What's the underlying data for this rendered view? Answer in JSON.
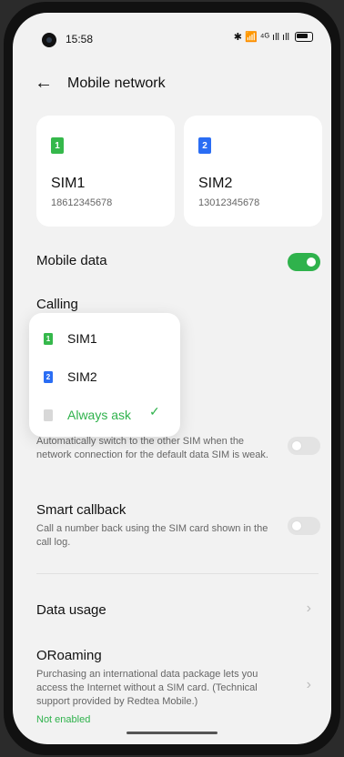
{
  "status": {
    "time": "15:58",
    "icons": "✱ 📶 ⁴ᴳ ıll ıll"
  },
  "header": {
    "back_label": "←",
    "title": "Mobile network"
  },
  "sims": [
    {
      "badge": "1",
      "name": "SIM1",
      "number": "18612345678",
      "color": "#35b84b"
    },
    {
      "badge": "2",
      "name": "SIM2",
      "number": "13012345678",
      "color": "#2a6df4"
    }
  ],
  "mobile_data": {
    "label": "Mobile data",
    "enabled": true
  },
  "calling": {
    "label": "Calling"
  },
  "dropdown": {
    "options": [
      "SIM1",
      "SIM2",
      "Always ask"
    ],
    "selected": "Always ask",
    "check": "✓"
  },
  "auto_switch": {
    "description": "Automatically switch to the other SIM when the network connection for the default data SIM is weak.",
    "enabled": false
  },
  "smart_callback": {
    "label": "Smart callback",
    "description": "Call a number back using the SIM card shown in the call log.",
    "enabled": false
  },
  "data_usage": {
    "label": "Data usage",
    "chevron": "›"
  },
  "oroaming": {
    "label": "ORoaming",
    "description": "Purchasing an international data package lets you access the Internet without a SIM card. (Technical support provided by Redtea Mobile.)",
    "status": "Not enabled",
    "chevron": "›"
  }
}
